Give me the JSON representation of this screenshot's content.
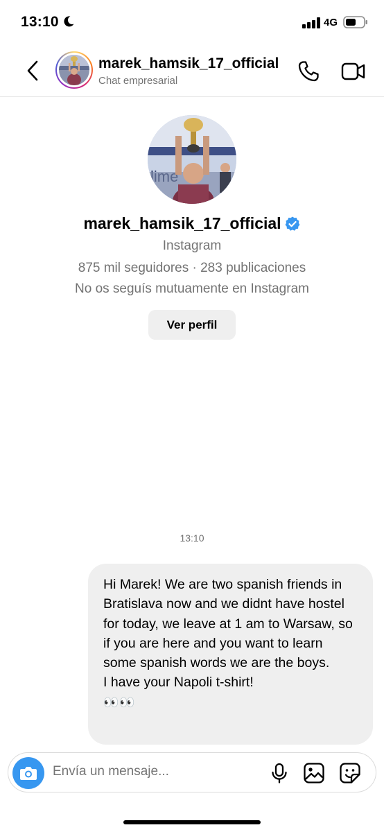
{
  "status_bar": {
    "time": "13:10",
    "network": "4G",
    "icons": [
      "moon-icon",
      "signal-icon",
      "battery-icon"
    ]
  },
  "header": {
    "title": "marek_hamsik_17_official",
    "subtitle": "Chat empresarial",
    "icons": [
      "back-icon",
      "phone-icon",
      "video-camera-icon"
    ]
  },
  "profile": {
    "username": "marek_hamsik_17_official",
    "platform": "Instagram",
    "stats": "875 mil seguidores · 283 publicaciones",
    "mutual_status": "No os seguís mutuamente en Instagram",
    "view_profile_label": "Ver perfil"
  },
  "conversation": {
    "timestamp": "13:10",
    "messages": [
      {
        "sender": "me",
        "lines": [
          "Hi Marek! We are two spanish friends in Bratislava now and we didnt have hostel for today, we leave at 1 am to Warsaw, so if you are here and you want to learn some spanish words we are the boys.",
          "I have your Napoli t-shirt!",
          "👀👀"
        ]
      }
    ]
  },
  "composer": {
    "placeholder": "Envía un mensaje...",
    "icons": [
      "camera-icon",
      "microphone-icon",
      "gallery-icon",
      "sticker-icon"
    ]
  },
  "colors": {
    "accent_blue": "#3797f0",
    "verified_blue": "#3897f0",
    "secondary_text": "#737373",
    "bubble_bg": "#efefef"
  }
}
